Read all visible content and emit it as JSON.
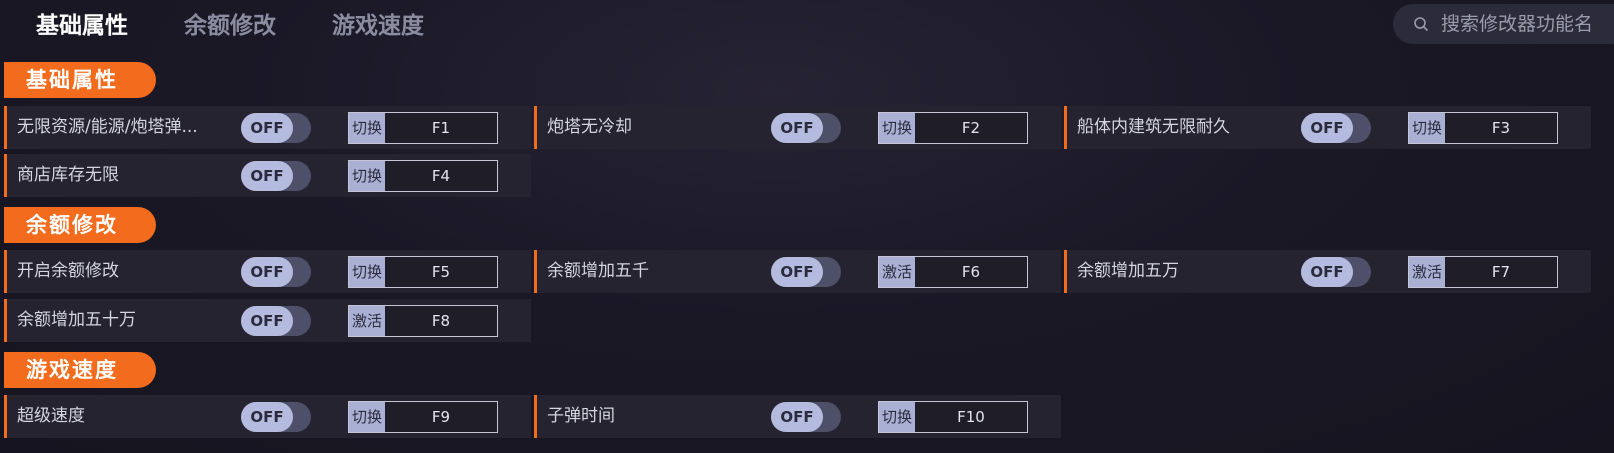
{
  "tabs": [
    {
      "label": "基础属性",
      "active": true
    },
    {
      "label": "余额修改",
      "active": false
    },
    {
      "label": "游戏速度",
      "active": false
    }
  ],
  "search": {
    "placeholder": "搜索修改器功能名"
  },
  "colors": {
    "accent": "#f36b1c",
    "row_bg": "#24232f",
    "toggle_knob": "#b5bbde"
  },
  "sections": [
    {
      "title": "基础属性",
      "items": [
        {
          "name": "无限资源/能源/炮塔弹...",
          "state": "OFF",
          "action": "切换",
          "key": "F1"
        },
        {
          "name": "炮塔无冷却",
          "state": "OFF",
          "action": "切换",
          "key": "F2"
        },
        {
          "name": "船体内建筑无限耐久",
          "state": "OFF",
          "action": "切换",
          "key": "F3"
        },
        {
          "name": "商店库存无限",
          "state": "OFF",
          "action": "切换",
          "key": "F4"
        }
      ]
    },
    {
      "title": "余额修改",
      "items": [
        {
          "name": "开启余额修改",
          "state": "OFF",
          "action": "切换",
          "key": "F5"
        },
        {
          "name": "余额增加五千",
          "state": "OFF",
          "action": "激活",
          "key": "F6"
        },
        {
          "name": "余额增加五万",
          "state": "OFF",
          "action": "激活",
          "key": "F7"
        },
        {
          "name": "余额增加五十万",
          "state": "OFF",
          "action": "激活",
          "key": "F8"
        }
      ]
    },
    {
      "title": "游戏速度",
      "items": [
        {
          "name": "超级速度",
          "state": "OFF",
          "action": "切换",
          "key": "F9"
        },
        {
          "name": "子弹时间",
          "state": "OFF",
          "action": "切换",
          "key": "F10"
        }
      ]
    }
  ]
}
